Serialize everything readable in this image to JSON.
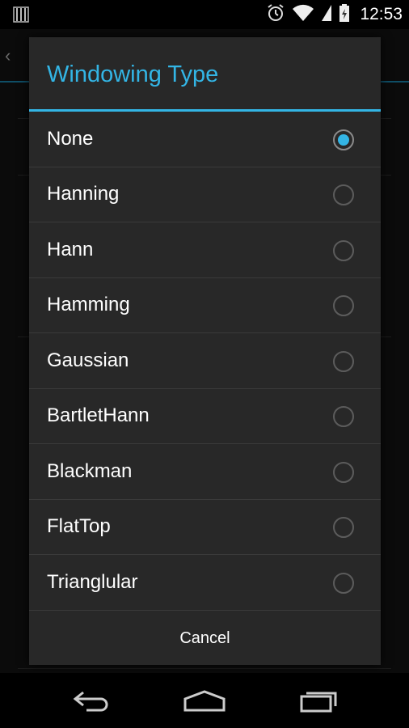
{
  "status_bar": {
    "time": "12:53",
    "icons": [
      "notification-icon",
      "alarm-icon",
      "wifi-icon",
      "signal-icon",
      "battery-icon"
    ]
  },
  "dialog": {
    "title": "Windowing Type",
    "accent_color": "#33b5e5",
    "options": [
      {
        "label": "None",
        "selected": true
      },
      {
        "label": "Hanning",
        "selected": false
      },
      {
        "label": "Hann",
        "selected": false
      },
      {
        "label": "Hamming",
        "selected": false
      },
      {
        "label": "Gaussian",
        "selected": false
      },
      {
        "label": "BartletHann",
        "selected": false
      },
      {
        "label": "Blackman",
        "selected": false
      },
      {
        "label": "FlatTop",
        "selected": false
      },
      {
        "label": "Trianglular",
        "selected": false
      }
    ],
    "cancel_label": "Cancel"
  },
  "nav_bar": {
    "buttons": [
      "back-icon",
      "home-icon",
      "recent-apps-icon"
    ]
  }
}
